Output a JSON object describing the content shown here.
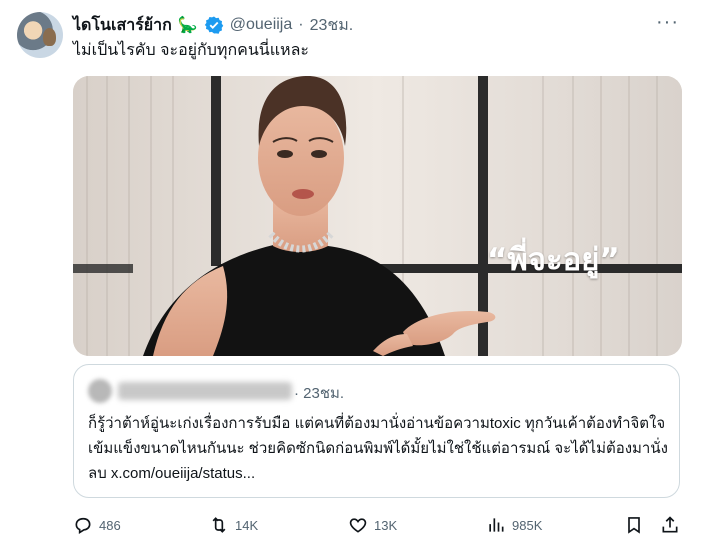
{
  "author": {
    "name": "ไดโนเสาร์ย้าก",
    "emoji": "🦕",
    "handle": "@oueiija",
    "separator": "·",
    "time": "23ชม."
  },
  "more_label": "···",
  "tweet_text": "ไม่เป็นไรคับ จะอยู่กับทุกคนนี่แหละ",
  "media": {
    "overlay_text": "“พี่จะอยู่”"
  },
  "quote": {
    "separator_time": "· 23ชม.",
    "text": "ก็รู้ว่าต้าห์อู่นะเก่งเรื่องการรับมือ แต่คนที่ต้องมานั่งอ่านข้อความtoxic ทุกวันเค้าต้องทำจิตใจเข้มแข็งขนาดไหนกันนะ ช่วยคิดซักนิดก่อนพิมพ์ได้มั้ยไม่ใช่ใช้แต่อารมณ์ จะได้ไม่ต้องมานั่งลบ x.com/oueiija/status..."
  },
  "actions": {
    "replies": "486",
    "reposts": "14K",
    "likes": "13K",
    "views": "985K"
  },
  "colors": {
    "verified": "#1d9bf0",
    "secondary_text": "#536471",
    "border": "#cfd9de"
  }
}
